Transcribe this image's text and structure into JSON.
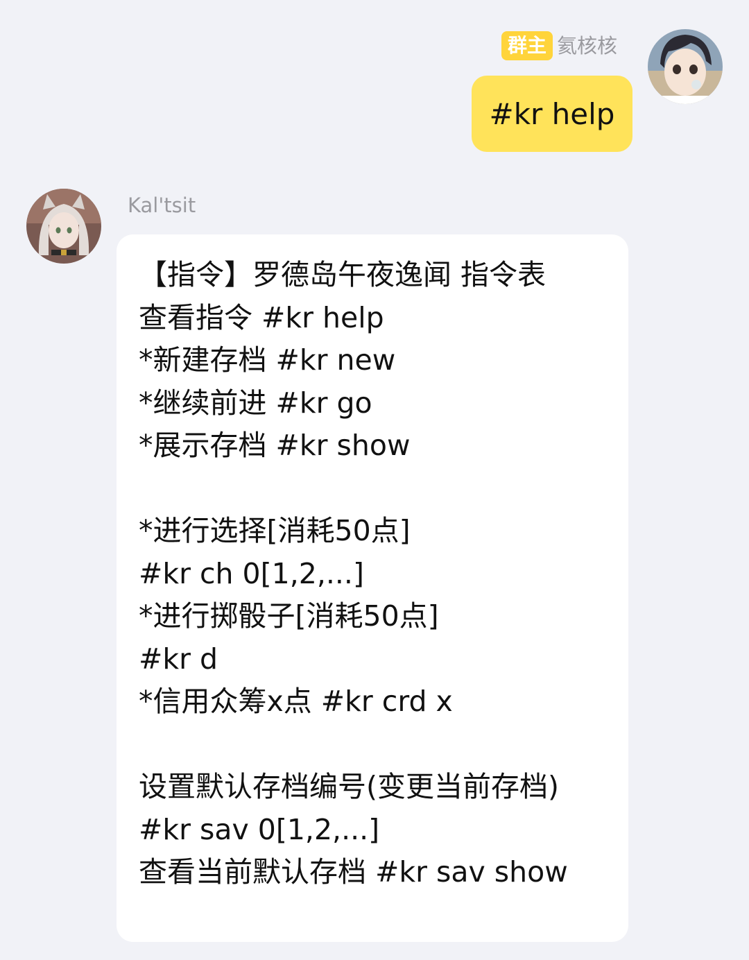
{
  "messages": [
    {
      "side": "right",
      "role_badge": "群主",
      "sender": "氦核核",
      "avatar": "anime-girl-avatar",
      "text": "#kr help",
      "bubble_color": "#ffe35a"
    },
    {
      "side": "left",
      "sender": "Kal'tsit",
      "avatar": "kaltsit-avatar",
      "bubble_color": "#ffffff",
      "lines": [
        "【指令】罗德岛午夜逸闻 指令表",
        "查看指令 #kr help",
        "*新建存档 #kr new",
        "*继续前进 #kr go",
        "*展示存档 #kr show",
        "",
        "*进行选择[消耗50点]",
        "#kr ch 0[1,2,...]",
        "*进行掷骰子[消耗50点]",
        "#kr d",
        "*信用众筹x点 #kr crd x",
        "",
        "设置默认存档编号(变更当前存档)",
        "#kr sav 0[1,2,...]",
        "查看当前默认存档 #kr sav show"
      ]
    }
  ],
  "colors": {
    "background": "#f1f2f7",
    "badge": "#ffd43b",
    "self_bubble": "#ffe35a",
    "other_bubble": "#ffffff",
    "name_text": "#9a9a9f"
  }
}
